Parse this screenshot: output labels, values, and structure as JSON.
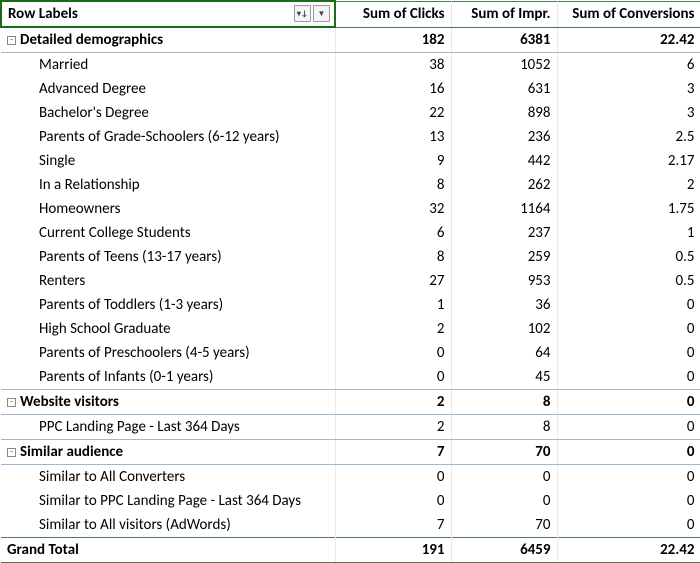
{
  "header": {
    "row_labels": "Row Labels",
    "clicks": "Sum of Clicks",
    "impr": "Sum of Impr.",
    "conv": "Sum of Conversions"
  },
  "groups": [
    {
      "label": "Detailed demographics",
      "clicks": "182",
      "impr": "6381",
      "conv": "22.42",
      "rows": [
        {
          "label": "Married",
          "clicks": "38",
          "impr": "1052",
          "conv": "6"
        },
        {
          "label": "Advanced Degree",
          "clicks": "16",
          "impr": "631",
          "conv": "3"
        },
        {
          "label": "Bachelor's Degree",
          "clicks": "22",
          "impr": "898",
          "conv": "3"
        },
        {
          "label": "Parents of Grade-Schoolers (6-12 years)",
          "clicks": "13",
          "impr": "236",
          "conv": "2.5"
        },
        {
          "label": "Single",
          "clicks": "9",
          "impr": "442",
          "conv": "2.17"
        },
        {
          "label": "In a Relationship",
          "clicks": "8",
          "impr": "262",
          "conv": "2"
        },
        {
          "label": "Homeowners",
          "clicks": "32",
          "impr": "1164",
          "conv": "1.75"
        },
        {
          "label": "Current College Students",
          "clicks": "6",
          "impr": "237",
          "conv": "1"
        },
        {
          "label": "Parents of Teens (13-17 years)",
          "clicks": "8",
          "impr": "259",
          "conv": "0.5"
        },
        {
          "label": "Renters",
          "clicks": "27",
          "impr": "953",
          "conv": "0.5"
        },
        {
          "label": "Parents of Toddlers (1-3 years)",
          "clicks": "1",
          "impr": "36",
          "conv": "0"
        },
        {
          "label": "High School Graduate",
          "clicks": "2",
          "impr": "102",
          "conv": "0"
        },
        {
          "label": "Parents of Preschoolers (4-5 years)",
          "clicks": "0",
          "impr": "64",
          "conv": "0"
        },
        {
          "label": "Parents of Infants (0-1 years)",
          "clicks": "0",
          "impr": "45",
          "conv": "0"
        }
      ]
    },
    {
      "label": "Website visitors",
      "clicks": "2",
      "impr": "8",
      "conv": "0",
      "rows": [
        {
          "label": "PPC Landing Page - Last 364 Days",
          "clicks": "2",
          "impr": "8",
          "conv": "0"
        }
      ]
    },
    {
      "label": "Similar audience",
      "clicks": "7",
      "impr": "70",
      "conv": "0",
      "rows": [
        {
          "label": "Similar to All Converters",
          "clicks": "0",
          "impr": "0",
          "conv": "0"
        },
        {
          "label": "Similar to PPC Landing Page - Last 364 Days",
          "clicks": "0",
          "impr": "0",
          "conv": "0"
        },
        {
          "label": "Similar to All visitors (AdWords)",
          "clicks": "7",
          "impr": "70",
          "conv": "0"
        }
      ]
    }
  ],
  "grand_total": {
    "label": "Grand Total",
    "clicks": "191",
    "impr": "6459",
    "conv": "22.42"
  },
  "chart_data": {
    "type": "table",
    "columns": [
      "Row Labels",
      "Sum of Clicks",
      "Sum of Impr.",
      "Sum of Conversions"
    ],
    "rows": [
      [
        "Detailed demographics",
        182,
        6381,
        22.42
      ],
      [
        "Married",
        38,
        1052,
        6
      ],
      [
        "Advanced Degree",
        16,
        631,
        3
      ],
      [
        "Bachelor's Degree",
        22,
        898,
        3
      ],
      [
        "Parents of Grade-Schoolers (6-12 years)",
        13,
        236,
        2.5
      ],
      [
        "Single",
        9,
        442,
        2.17
      ],
      [
        "In a Relationship",
        8,
        262,
        2
      ],
      [
        "Homeowners",
        32,
        1164,
        1.75
      ],
      [
        "Current College Students",
        6,
        237,
        1
      ],
      [
        "Parents of Teens (13-17 years)",
        8,
        259,
        0.5
      ],
      [
        "Renters",
        27,
        953,
        0.5
      ],
      [
        "Parents of Toddlers (1-3 years)",
        1,
        36,
        0
      ],
      [
        "High School Graduate",
        2,
        102,
        0
      ],
      [
        "Parents of Preschoolers (4-5 years)",
        0,
        64,
        0
      ],
      [
        "Parents of Infants (0-1 years)",
        0,
        45,
        0
      ],
      [
        "Website visitors",
        2,
        8,
        0
      ],
      [
        "PPC Landing Page - Last 364 Days",
        2,
        8,
        0
      ],
      [
        "Similar audience",
        7,
        70,
        0
      ],
      [
        "Similar to All Converters",
        0,
        0,
        0
      ],
      [
        "Similar to PPC Landing Page - Last 364 Days",
        0,
        0,
        0
      ],
      [
        "Similar to All visitors (AdWords)",
        7,
        70,
        0
      ],
      [
        "Grand Total",
        191,
        6459,
        22.42
      ]
    ]
  }
}
